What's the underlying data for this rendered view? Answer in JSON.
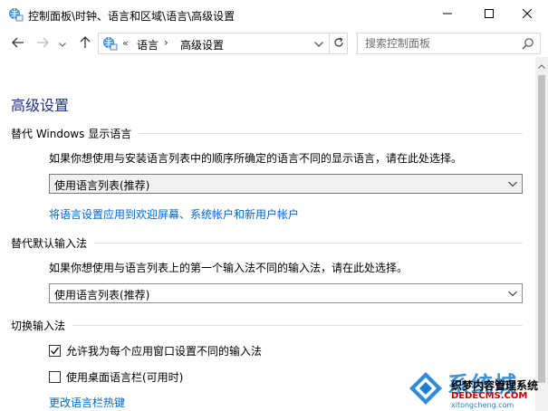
{
  "window": {
    "title": "控制面板\\时钟、语言和区域\\语言\\高级设置",
    "title_icon": "control-panel-language-icon",
    "buttons": {
      "minimize": "minimize-icon",
      "maximize": "maximize-icon",
      "close": "close-icon"
    }
  },
  "nav": {
    "back_icon": "arrow-left-icon",
    "forward_icon": "arrow-right-icon",
    "recent_icon": "chevron-down-icon",
    "up_icon": "arrow-up-icon",
    "address": {
      "overflow": "«",
      "crumbs": [
        "语言",
        "高级设置"
      ],
      "separator": "›"
    },
    "search_placeholder": "搜索控制面板"
  },
  "main": {
    "title": "高级设置",
    "sections": [
      {
        "heading": "替代 Windows 显示语言",
        "description": "如果你想使用与安装语言列表中的顺序所确定的语言不同的显示语言，请在此处选择。",
        "select_value": "使用语言列表(推荐)",
        "link": "将语言设置应用到欢迎屏幕、系统帐户和新用户帐户"
      },
      {
        "heading": "替代默认输入法",
        "description": "如果你想使用与语言列表上的第一个输入法不同的输入法，请在此处选择。",
        "select_value": "使用语言列表(推荐)"
      },
      {
        "heading": "切换输入法",
        "checkboxes": [
          {
            "label": "允许我为每个应用窗口设置不同的输入法",
            "checked": true
          },
          {
            "label": "使用桌面语言栏(可用时)",
            "checked": false
          }
        ],
        "link": "更改语言栏热键"
      }
    ]
  },
  "watermark": {
    "big": "系统城",
    "line1": "织梦内容管理系统",
    "url": "DEDECMS.COM",
    "small": "xitongcheng.com",
    "colors": {
      "blue": "#1a7fd4",
      "red": "#c40000"
    }
  },
  "colors": {
    "title_blue": "#1e3287",
    "link_blue": "#0066cc"
  }
}
